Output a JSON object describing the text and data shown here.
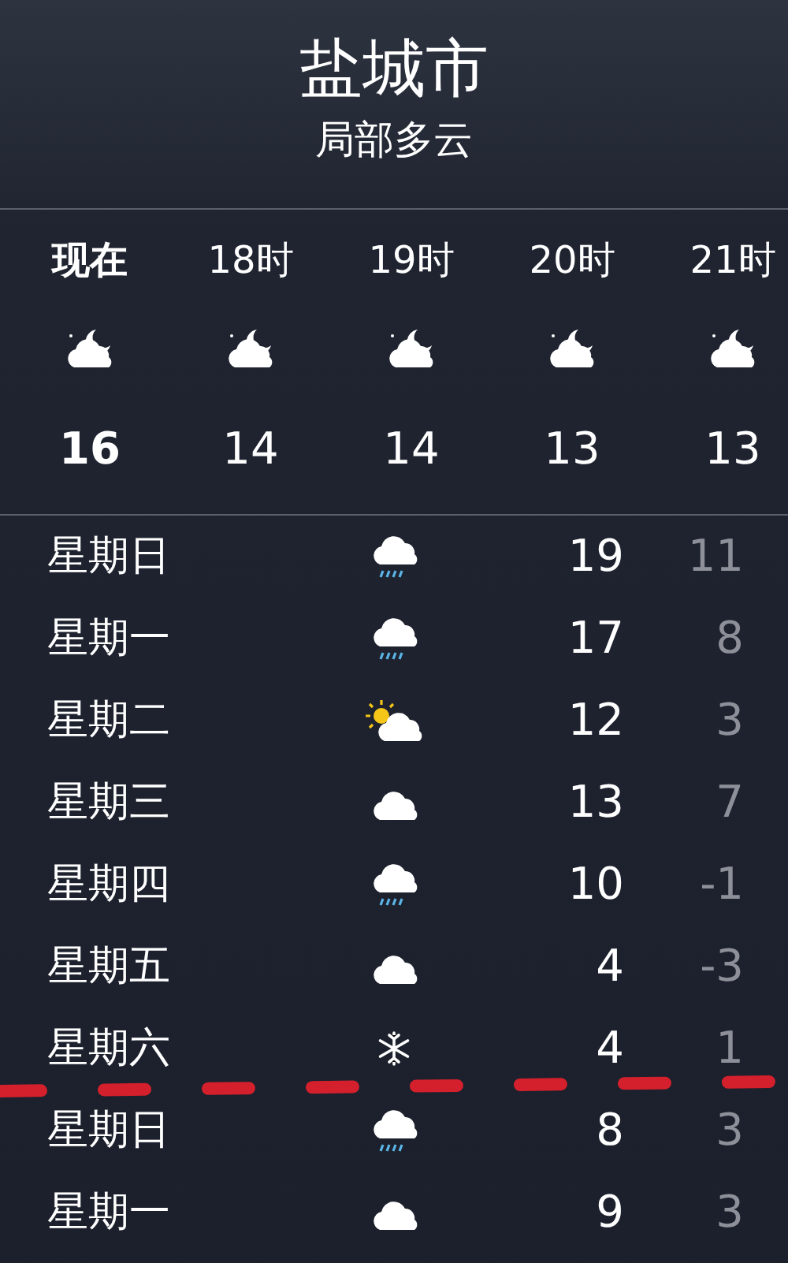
{
  "location": {
    "city": "盐城市",
    "condition": "局部多云"
  },
  "hourly": [
    {
      "time": "现在",
      "kind": "moon-cloud",
      "temp": "16",
      "current": true
    },
    {
      "time": "18时",
      "kind": "moon-cloud",
      "temp": "14",
      "current": false
    },
    {
      "time": "19时",
      "kind": "moon-cloud",
      "temp": "14",
      "current": false
    },
    {
      "time": "20时",
      "kind": "moon-cloud",
      "temp": "13",
      "current": false
    },
    {
      "time": "21时",
      "kind": "moon-cloud",
      "temp": "13",
      "current": false
    }
  ],
  "daily": [
    {
      "day": "星期日",
      "kind": "rain",
      "high": "19",
      "low": "11"
    },
    {
      "day": "星期一",
      "kind": "rain",
      "high": "17",
      "low": "8"
    },
    {
      "day": "星期二",
      "kind": "sun-cloud",
      "high": "12",
      "low": "3"
    },
    {
      "day": "星期三",
      "kind": "cloud",
      "high": "13",
      "low": "7"
    },
    {
      "day": "星期四",
      "kind": "rain",
      "high": "10",
      "low": "-1"
    },
    {
      "day": "星期五",
      "kind": "cloud",
      "high": "4",
      "low": "-3"
    },
    {
      "day": "星期六",
      "kind": "snow",
      "high": "4",
      "low": "1"
    },
    {
      "day": "星期日",
      "kind": "rain",
      "high": "8",
      "low": "3"
    },
    {
      "day": "星期一",
      "kind": "cloud",
      "high": "9",
      "low": "3"
    }
  ]
}
